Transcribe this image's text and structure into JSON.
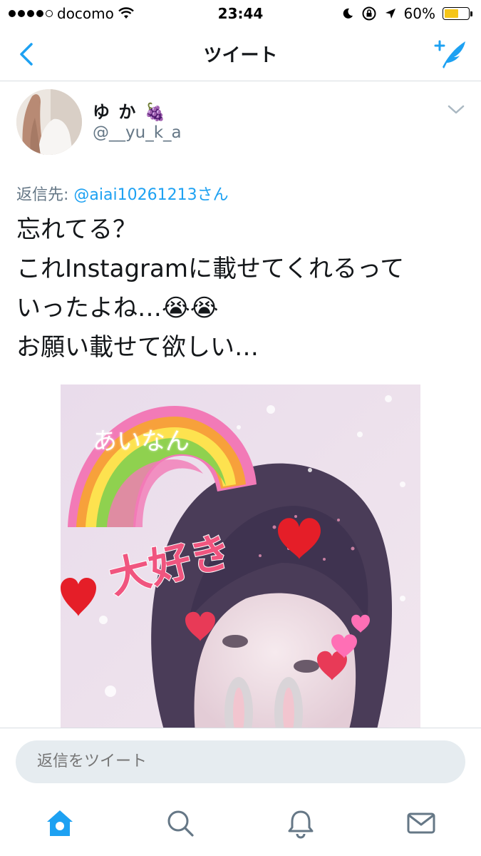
{
  "status_bar": {
    "carrier": "docomo",
    "time": "23:44",
    "battery_percent": "60%",
    "battery_level": 0.6,
    "signal_bars_filled": 4,
    "signal_bars_total": 5
  },
  "nav": {
    "title": "ツイート",
    "back_icon": "chevron-left-icon",
    "compose_icon": "compose-tweet-icon"
  },
  "tweet": {
    "display_name": "ゆ か 🍇",
    "username": "@__yu_k_a",
    "reply_prefix": "返信先: ",
    "reply_mention": "@aiai10261213さん",
    "lines": [
      "忘れてる？",
      "これInstagramに載せてくれるって",
      "いったよね…😭😭",
      "お願い載せて欲しい…"
    ],
    "media_stickers": {
      "rainbow_label": "あいなん",
      "main_label": "大好き"
    }
  },
  "reply_bar": {
    "placeholder": "返信をツイート"
  },
  "tabs": [
    {
      "icon": "home-icon",
      "active": true
    },
    {
      "icon": "search-icon",
      "active": false
    },
    {
      "icon": "notifications-bell-icon",
      "active": false
    },
    {
      "icon": "messages-envelope-icon",
      "active": false
    }
  ],
  "colors": {
    "accent": "#1da1f2",
    "secondary_text": "#657786",
    "battery": "#f5c518"
  }
}
